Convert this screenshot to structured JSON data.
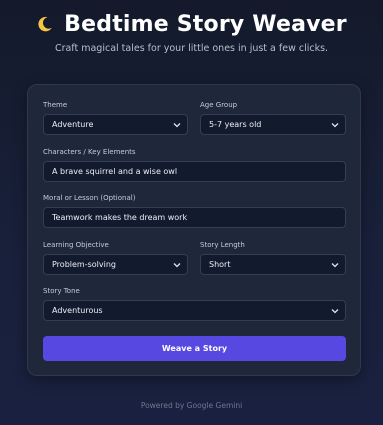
{
  "header": {
    "title": "Bedtime Story Weaver",
    "subtitle": "Craft magical tales for your little ones in just a few clicks.",
    "icon": "crescent-moon-icon",
    "icon_color": "#f5c542"
  },
  "form": {
    "theme": {
      "label": "Theme",
      "value": "Adventure"
    },
    "age_group": {
      "label": "Age Group",
      "value": "5-7 years old"
    },
    "characters": {
      "label": "Characters / Key Elements",
      "value": "A brave squirrel and a wise owl"
    },
    "moral": {
      "label": "Moral or Lesson (Optional)",
      "value": "Teamwork makes the dream work"
    },
    "learning_objective": {
      "label": "Learning Objective",
      "value": "Problem-solving"
    },
    "story_length": {
      "label": "Story Length",
      "value": "Short"
    },
    "story_tone": {
      "label": "Story Tone",
      "value": "Adventurous"
    },
    "submit_label": "Weave a Story"
  },
  "footer": {
    "text": "Powered by Google Gemini"
  },
  "colors": {
    "accent": "#5848e2",
    "card_bg": "#1f273a",
    "input_bg": "#121a2e"
  }
}
